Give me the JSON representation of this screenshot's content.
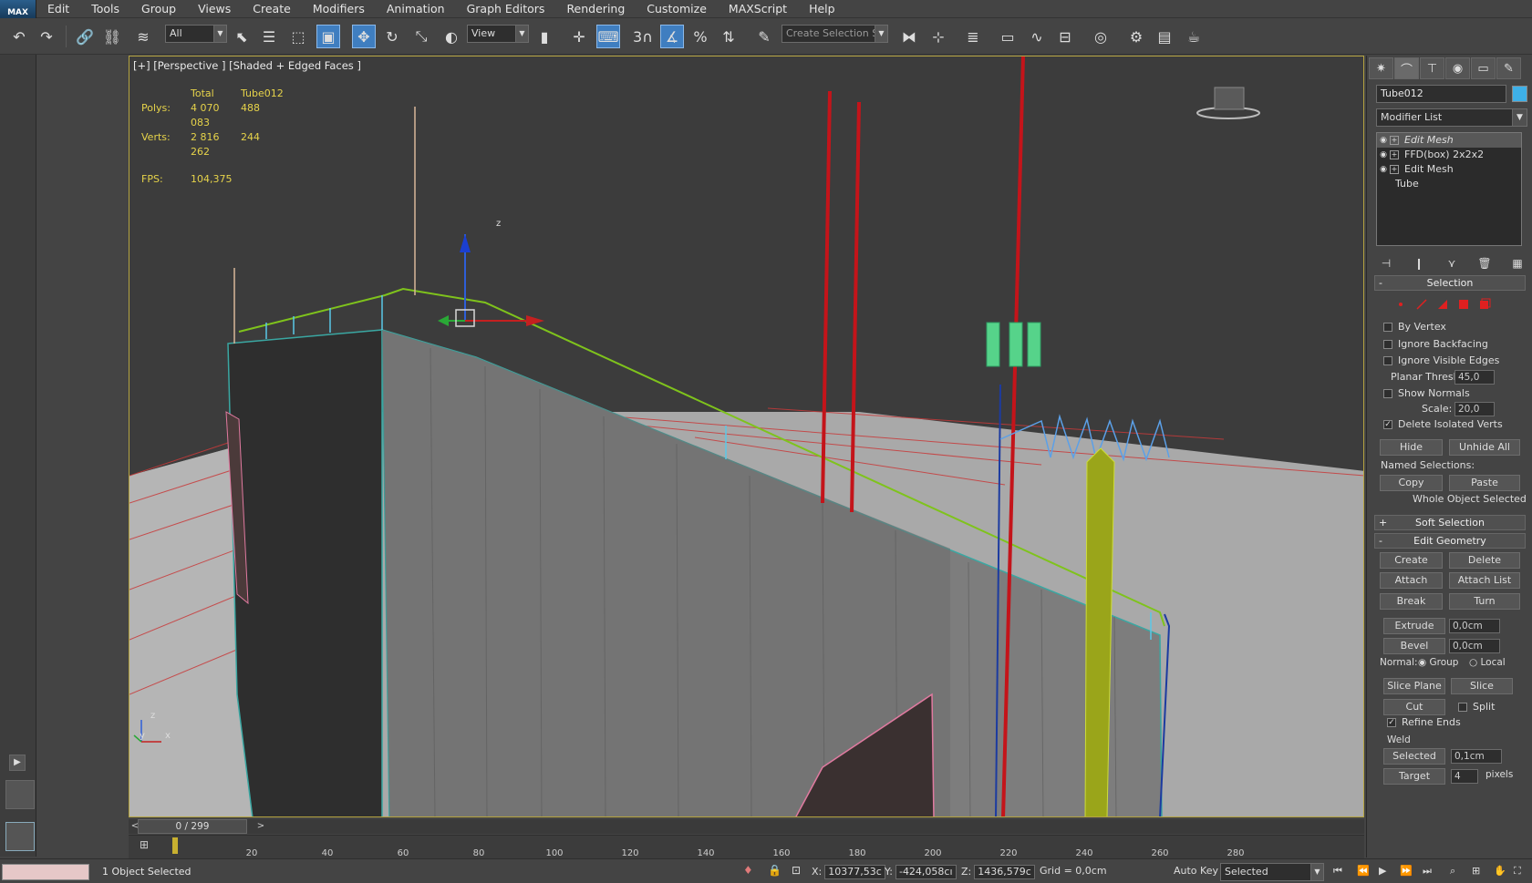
{
  "app": {
    "logo_text": "MAX"
  },
  "menu": [
    "Edit",
    "Tools",
    "Group",
    "Views",
    "Create",
    "Modifiers",
    "Animation",
    "Graph Editors",
    "Rendering",
    "Customize",
    "MAXScript",
    "Help"
  ],
  "toolbar": {
    "selection_filter": "All",
    "ref_coord": "View",
    "named_selection_placeholder": "Create Selection Se",
    "snap_label": "3"
  },
  "viewport": {
    "label": "[+] [Perspective ] [Shaded + Edged Faces ]",
    "stats": {
      "header_total": "Total",
      "header_obj": "Tube012",
      "polys_label": "Polys:",
      "polys_total": "4 070 083",
      "polys_obj": "488",
      "verts_label": "Verts:",
      "verts_total": "2 816 262",
      "verts_obj": "244",
      "fps_label": "FPS:",
      "fps_value": "104,375"
    },
    "gizmo_axis": "z",
    "tripod_z": "z",
    "tripod_y": "y",
    "tripod_x": "x"
  },
  "command_panel": {
    "object_name": "Tube012",
    "object_color": "#3eb0e8",
    "modifier_list": "Modifier List",
    "stack": [
      {
        "name": "Edit Mesh",
        "selected": true
      },
      {
        "name": "FFD(box) 2x2x2",
        "selected": false
      },
      {
        "name": "Edit Mesh",
        "selected": false
      },
      {
        "name": "Tube",
        "selected": false
      }
    ],
    "selection": {
      "title": "Selection",
      "by_vertex": "By Vertex",
      "ignore_backfacing": "Ignore Backfacing",
      "ignore_visible_edges": "Ignore Visible Edges",
      "planar_thresh": "Planar Thresh:",
      "planar_thresh_value": "45,0",
      "show_normals": "Show Normals",
      "scale": "Scale:",
      "scale_value": "20,0",
      "delete_isolated": "Delete Isolated Verts",
      "hide": "Hide",
      "unhide_all": "Unhide All",
      "named_selections": "Named Selections:",
      "copy": "Copy",
      "paste": "Paste",
      "status": "Whole Object Selected"
    },
    "soft_selection": {
      "title": "Soft Selection"
    },
    "edit_geometry": {
      "title": "Edit Geometry",
      "create": "Create",
      "delete": "Delete",
      "attach": "Attach",
      "attach_list": "Attach List",
      "break": "Break",
      "turn": "Turn",
      "extrude": "Extrude",
      "extrude_value": "0,0cm",
      "bevel": "Bevel",
      "bevel_value": "0,0cm",
      "normal": "Normal:",
      "group": "Group",
      "local": "Local",
      "slice_plane": "Slice Plane",
      "slice": "Slice",
      "cut": "Cut",
      "split": "Split",
      "refine_ends": "Refine Ends",
      "weld": "Weld",
      "selected": "Selected",
      "selected_value": "0,1cm",
      "target": "Target",
      "target_value": "4",
      "pixels": "pixels"
    }
  },
  "timeline": {
    "frame": "0 / 299",
    "ticks": [
      "20",
      "40",
      "60",
      "80",
      "100",
      "120",
      "140",
      "160",
      "180",
      "200",
      "220",
      "240",
      "260",
      "280"
    ]
  },
  "status": {
    "message": "1 Object Selected",
    "x_label": "X:",
    "x_value": "10377,53c",
    "y_label": "Y:",
    "y_value": "-424,058cı",
    "z_label": "Z:",
    "z_value": "1436,579c",
    "grid": "Grid = 0,0cm",
    "auto_key": "Auto Key",
    "key_mode": "Selected"
  }
}
